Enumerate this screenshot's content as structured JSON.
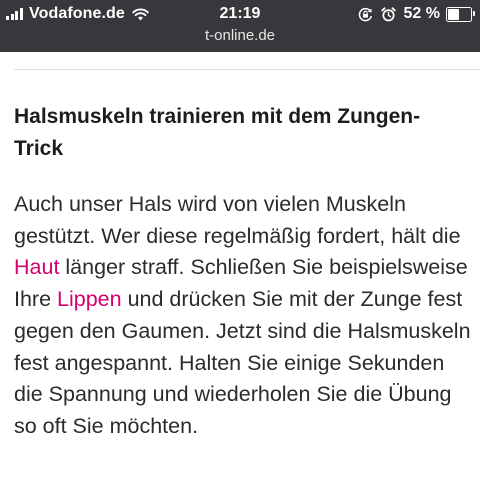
{
  "status_bar": {
    "carrier": "Vodafone.de",
    "time": "21:19",
    "battery_percent": "52 %",
    "battery_level": 0.52,
    "icons": [
      "signal-icon",
      "wifi-icon",
      "rotation-lock-icon",
      "alarm-icon",
      "battery-icon"
    ]
  },
  "browser": {
    "url": "t-online.de"
  },
  "article": {
    "headline": "Halsmuskeln trainieren mit dem Zungen-Trick",
    "paragraph": {
      "part1": "Auch unser Hals wird von vielen Muskeln gestützt. Wer diese regelmäßig fordert, hält die ",
      "link1": "Haut",
      "part2": " länger straff. Schließen Sie beispielsweise Ihre ",
      "link2": "Lippen",
      "part3": " und drücken Sie mit der Zunge fest gegen den Gaumen. Jetzt sind die Halsmuskeln fest angespannt. Halten Sie einige Sekunden die Spannung und wiederholen Sie die Übung so oft Sie möchten."
    },
    "link_color": "#d4006e"
  }
}
